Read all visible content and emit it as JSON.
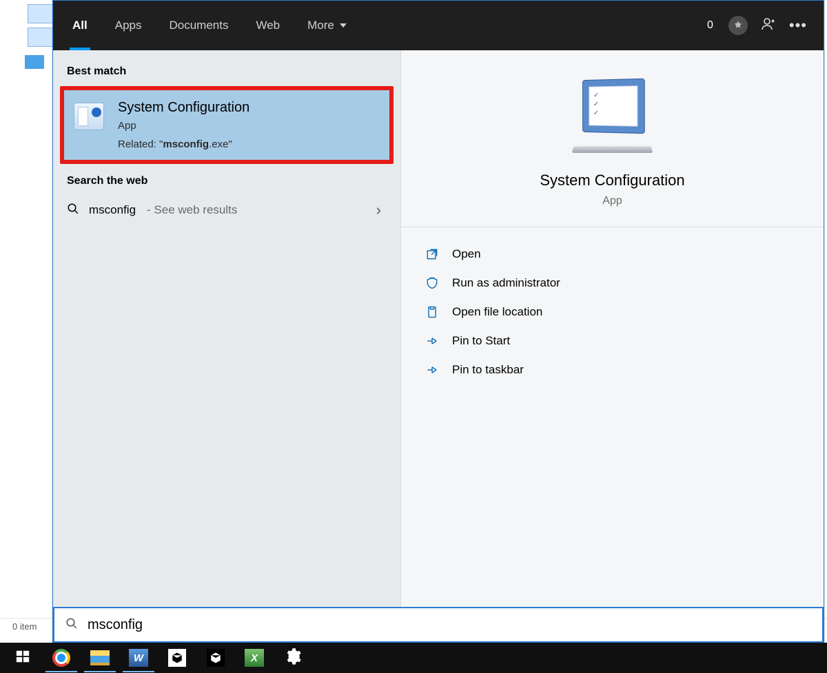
{
  "statusBar": {
    "label": "0 item"
  },
  "categoryBar": {
    "items": [
      {
        "label": "All",
        "active": true
      },
      {
        "label": "Apps",
        "active": false
      },
      {
        "label": "Documents",
        "active": false
      },
      {
        "label": "Web",
        "active": false
      },
      {
        "label": "More",
        "active": false,
        "hasCaret": true
      }
    ],
    "rewards": {
      "count": "0"
    }
  },
  "results": {
    "bestMatchHeading": "Best match",
    "bestMatch": {
      "title": "System Configuration",
      "type": "App",
      "relatedPrefix": "Related: \"",
      "relatedBold": "msconfig",
      "relatedSuffix": ".exe\""
    },
    "webHeading": "Search the web",
    "webResult": {
      "query": "msconfig",
      "suffix": "- See web results"
    }
  },
  "preview": {
    "title": "System Configuration",
    "type": "App",
    "actions": [
      {
        "id": "open",
        "label": "Open"
      },
      {
        "id": "run-admin",
        "label": "Run as administrator"
      },
      {
        "id": "open-location",
        "label": "Open file location"
      },
      {
        "id": "pin-start",
        "label": "Pin to Start"
      },
      {
        "id": "pin-taskbar",
        "label": "Pin to taskbar"
      }
    ]
  },
  "searchBox": {
    "value": "msconfig"
  },
  "taskbar": {
    "items": [
      {
        "id": "start",
        "name": "Start"
      },
      {
        "id": "chrome",
        "name": "Google Chrome"
      },
      {
        "id": "explorer",
        "name": "File Explorer"
      },
      {
        "id": "word",
        "name": "Microsoft Word"
      },
      {
        "id": "unity-white",
        "name": "Unity Hub"
      },
      {
        "id": "unity-black",
        "name": "Unity"
      },
      {
        "id": "excel",
        "name": "Microsoft Excel"
      },
      {
        "id": "settings",
        "name": "Settings"
      }
    ]
  }
}
